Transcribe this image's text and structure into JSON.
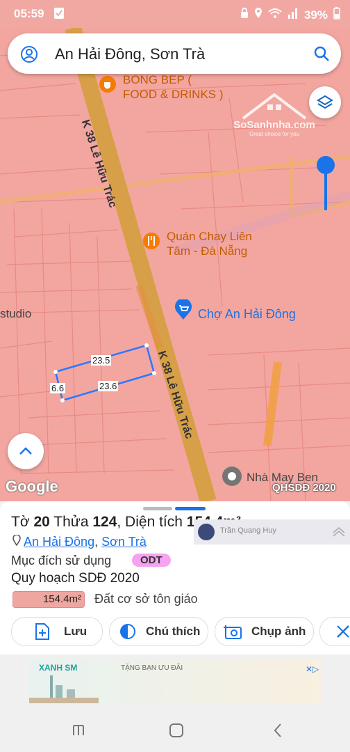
{
  "status": {
    "time": "05:59",
    "battery": "39%"
  },
  "search": {
    "query": "An Hải Đông, Sơn Trà"
  },
  "map": {
    "pois": [
      {
        "name": "BONG BEP ( FOOD & DRINKS )",
        "line1": "BONG BEP (",
        "line2": "FOOD & DRINKS )"
      },
      {
        "line1": "Quán Chay Liên",
        "line2": "Tâm - Đà Nẵng"
      },
      {
        "line1": "Chợ An Hải Đông"
      },
      {
        "line1": "Nhà May Ben"
      }
    ],
    "road_top": "K 38 Lê Hữu Trác",
    "road_bottom": "K 38 Lê Hữu Trác",
    "studio": "studio",
    "watermark_brand": "SoSanhnha.com",
    "watermark_tag": "Great choice for you",
    "parcel_dims": {
      "top": "23.5",
      "bottom": "23.6",
      "left": "6.6"
    },
    "google": "Google",
    "qhsdd": "QHSDĐ 2020"
  },
  "sheet": {
    "title_prefix": "Tờ ",
    "to_num": "20",
    "thua_label": " Thửa ",
    "thua_num": "124",
    "dt_label": ", Diện tích ",
    "dt_value": "154.4m²",
    "loc1": "An Hải Đông",
    "loc_sep": ", ",
    "loc2": "Sơn Trà",
    "purpose_label": "Mục đích sử dụng",
    "purpose_badge": "ODT",
    "plan_label": "Quy hoạch SDĐ 2020",
    "plan_area": "154.4m²",
    "plan_type": "Đất cơ sở tôn giáo",
    "overlay_name": "Trần Quang Huy",
    "buttons": {
      "save": "Lưu",
      "note": "Chú thích",
      "photo": "Chụp ảnh"
    }
  },
  "ad": {
    "brand": "XANH SM",
    "text": "TẶNG BẠN ƯU ĐÃI"
  },
  "colors": {
    "map_bg": "#f3a6a0",
    "road": "#e0a040",
    "accent": "#1a73e8",
    "badge": "#f5a3f0"
  }
}
